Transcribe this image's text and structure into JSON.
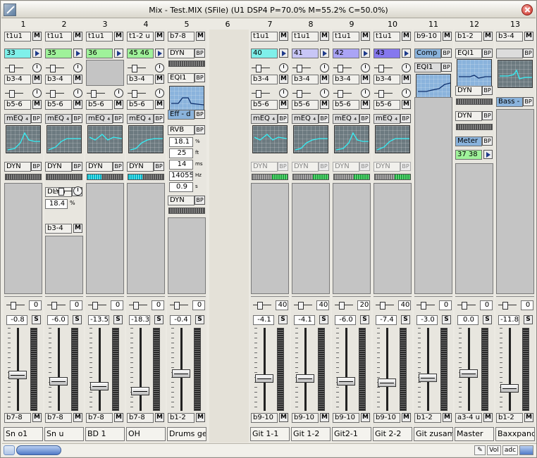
{
  "window": {
    "title": "Mix - Test.MIX (SFile) (U1 DSP4 P=70.0% M=55.2% C=50.0%)"
  },
  "columns": [
    "1",
    "2",
    "3",
    "4",
    "5",
    "6",
    "7",
    "8",
    "9",
    "10",
    "11",
    "12",
    "13"
  ],
  "strips": [
    {
      "input": "t1u1",
      "aux": [
        {
          "v": "33",
          "c": "#7ff0ea"
        },
        {
          "v": "b3-4"
        },
        {
          "v": "b5-6"
        }
      ],
      "dsp": "mEQ ₄",
      "dyn": "DYN",
      "extra": null,
      "pan": "0",
      "level": "-0.8",
      "out": "b7-8",
      "name": "Sn o1",
      "fader": 0.43
    },
    {
      "input": "t1u1",
      "aux": [
        {
          "v": "35",
          "c": "#9ff29a"
        },
        {
          "v": "b3-4"
        },
        {
          "v": "b5-6"
        }
      ],
      "dsp": "mEQ ₄",
      "dyn": "DYN",
      "extra": {
        "label": "DLY.n",
        "value": "18.4",
        "unit": "%",
        "send": "b3-4"
      },
      "pan": "0",
      "level": "-6.0",
      "out": "b7-8",
      "name": "Sn u",
      "fader": 0.36
    },
    {
      "input": "t1u1",
      "aux": [
        {
          "v": "36",
          "c": "#9ff29a"
        },
        {
          "v": ""
        },
        {
          "v": "b5-6"
        }
      ],
      "dsp": "mEQ ₄",
      "dyn": "DYN",
      "extra": null,
      "pan": "0",
      "level": "-13.5",
      "out": "b7-8",
      "name": "BD 1",
      "fader": 0.3
    },
    {
      "input": "t1-2 u",
      "aux": [
        {
          "v": "45 46",
          "c": "#9ff29a"
        },
        {
          "v": "b3-4"
        },
        {
          "v": "b5-6"
        }
      ],
      "dsp": "mEQ ₄",
      "dyn": "DYN",
      "extra": null,
      "pan": "0",
      "level": "-18.3",
      "out": "b7-8",
      "name": "OH",
      "fader": 0.24
    },
    {
      "input": "b7-8",
      "group": true,
      "pan": "0",
      "level": "-0.4",
      "out": "b1-2",
      "name": "Drums ges.",
      "fader": 0.45
    },
    null,
    {
      "input": "t1u1",
      "aux": [
        {
          "v": "40",
          "c": "#7ff0ea"
        },
        {
          "v": "b3-4"
        },
        {
          "v": "b5-6"
        }
      ],
      "dsp": "mEQ ₄",
      "dyn": "DYN",
      "dim": true,
      "pan": "40",
      "level": "-4.1",
      "out": "b9-10",
      "name": "Git 1-1",
      "fader": 0.39
    },
    {
      "input": "t1u1",
      "aux": [
        {
          "v": "41",
          "c": "#c8c6f6"
        },
        {
          "v": "b3-4"
        },
        {
          "v": "b5-6"
        }
      ],
      "dsp": "mEQ ₄",
      "dyn": "DYN",
      "dim": true,
      "pan": "40",
      "level": "-4.1",
      "out": "b9-10",
      "name": "Git 1-2",
      "fader": 0.39
    },
    {
      "input": "t1u1",
      "aux": [
        {
          "v": "42",
          "c": "#aaa4f6"
        },
        {
          "v": "b3-4"
        },
        {
          "v": "b5-6"
        }
      ],
      "dsp": "mEQ ₄",
      "dyn": "DYN",
      "dim": true,
      "pan": "20",
      "level": "-6.0",
      "out": "b9-10",
      "name": "Git2-1",
      "fader": 0.36
    },
    {
      "input": "t1u1",
      "aux": [
        {
          "v": "43",
          "c": "#8578ee"
        },
        {
          "v": "b3-4"
        },
        {
          "v": "b5-6"
        }
      ],
      "dsp": "mEQ ₄",
      "dyn": "DYN",
      "dim": true,
      "pan": "40",
      "level": "-7.4",
      "out": "b9-10",
      "name": "Git 2-2",
      "fader": 0.34
    },
    {
      "input": "b9-10",
      "comp": true,
      "pan": "0",
      "level": "-3.0",
      "out": "b1-2",
      "name": "Git zusamm",
      "fader": 0.4
    },
    {
      "input": "b1-2",
      "master": true,
      "meter": "37 38",
      "pan": "0",
      "level": "0.0",
      "out": "a3-4 u",
      "name": "Master",
      "fader": 0.45
    },
    {
      "input": "b3-4",
      "bass": true,
      "bassLabel": "Bass -",
      "pan": "0",
      "level": "-11.8",
      "out": "b1-2",
      "name": "Baxxpander",
      "fader": 0.27
    }
  ],
  "group5": {
    "dyn": "DYN",
    "eq": "EQI1",
    "eff": "Eff - d",
    "rvb": "RVB",
    "params": [
      [
        "18.1",
        "%"
      ],
      [
        "25",
        "ft"
      ],
      [
        "14",
        "ms"
      ],
      [
        "14055",
        "Hz"
      ],
      [
        "0.9",
        "s"
      ]
    ],
    "dyn2": "DYN"
  },
  "group11": {
    "comp": "Comp",
    "eq": "EQI1"
  },
  "group12": {
    "eq": "EQI1",
    "dyn1": "DYN",
    "dyn2": "DYN",
    "meter": "Meter"
  },
  "labels": {
    "mute": "M",
    "solo": "S",
    "bypass": "BP"
  },
  "tray": [
    "✎",
    "Vol",
    "adc"
  ]
}
